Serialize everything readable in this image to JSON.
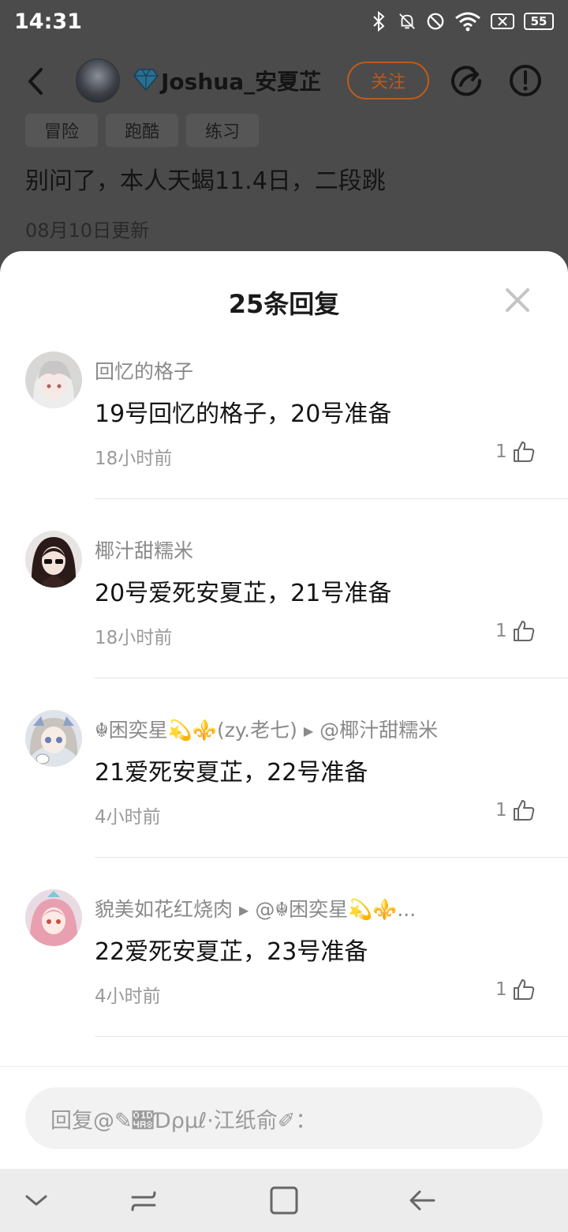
{
  "status": {
    "time": "14:31",
    "battery": "55",
    "icons": [
      "bluetooth-icon",
      "mute-icon",
      "dnd-icon",
      "wifi-icon",
      "no-sim-icon",
      "battery-icon"
    ]
  },
  "header": {
    "username": "Joshua_安夏芷",
    "follow_label": "关注"
  },
  "post": {
    "tags": [
      "冒险",
      "跑酷",
      "练习"
    ],
    "text": "别问了，本人天蝎11.4日，二段跳",
    "date": "08月10日更新"
  },
  "sheet": {
    "title": "25条回复"
  },
  "replies": [
    {
      "name": "回忆的格子",
      "reply_to": "",
      "text": "19号回忆的格子，20号准备",
      "time": "18小时前",
      "likes": "1"
    },
    {
      "name": "椰汁甜糯米",
      "reply_to": "",
      "text": "20号爱死安夏芷，21号准备",
      "time": "18小时前",
      "likes": "1"
    },
    {
      "name": "☬困奕星💫⚜️(zy.老七)",
      "reply_to": "@椰汁甜糯米",
      "text": "21爱死安夏芷，22号准备",
      "time": "4小时前",
      "likes": "1"
    },
    {
      "name": "貌美如花红烧肉",
      "reply_to": "@☬困奕星💫⚜️...",
      "text": "22爱死安夏芷，23号准备",
      "time": "4小时前",
      "likes": "1"
    }
  ],
  "input": {
    "placeholder": "回复@✎𝒨Ɗρμℓ·江纸俞✐："
  },
  "colors": {
    "accent": "#c05a1a",
    "overlay": "#4b4b4b"
  }
}
